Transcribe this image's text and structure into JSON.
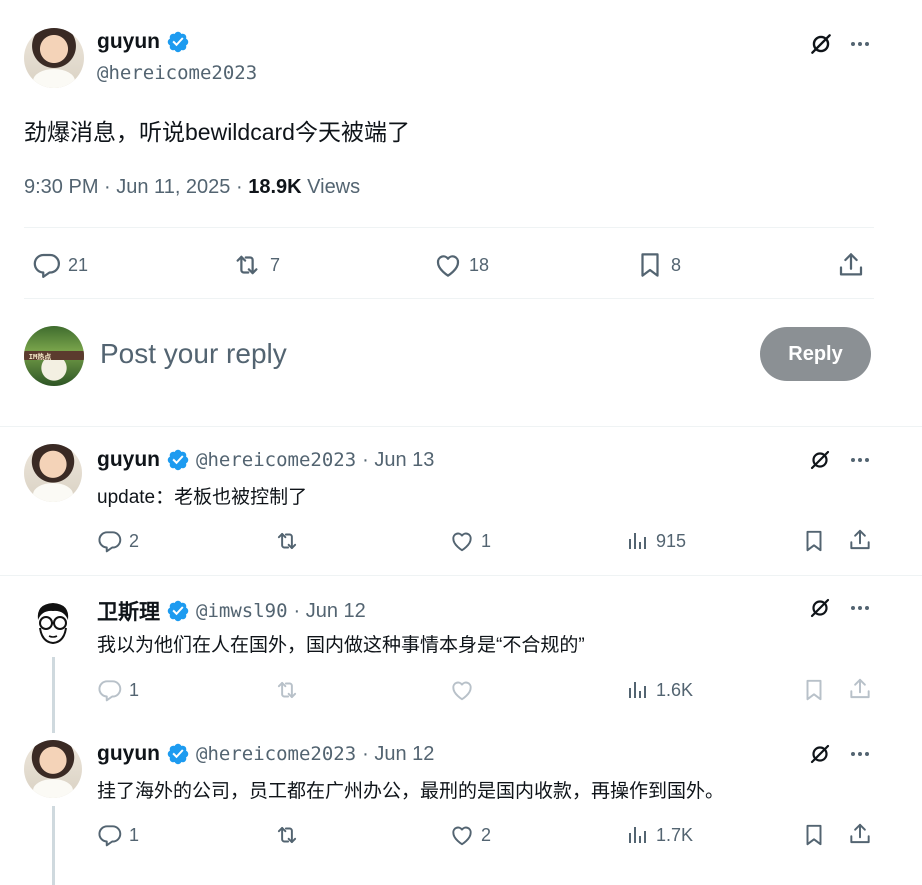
{
  "main_post": {
    "author": "guyun",
    "handle": "@hereicome2023",
    "text": "劲爆消息，听说bewildcard今天被端了",
    "time": "9:30 PM · Jun 11, 2025 · ",
    "views_count": "18.9K",
    "views_label": "Views",
    "actions": {
      "replies": "21",
      "reposts": "7",
      "likes": "18",
      "bookmarks": "8"
    }
  },
  "composer": {
    "placeholder": "Post your reply",
    "button_label": "Reply"
  },
  "replies": [
    {
      "author": "guyun",
      "handle": "@hereicome2023",
      "date": "· Jun 13",
      "text": "update：老板也被控制了",
      "actions": {
        "replies": "2",
        "reposts": "",
        "likes": "1",
        "views": "915"
      }
    },
    {
      "author": "卫斯理",
      "handle": "@imwsl90",
      "date": "· Jun 12",
      "text": "我以为他们在人在国外，国内做这种事情本身是“不合规的”",
      "actions": {
        "replies": "1",
        "reposts": "",
        "likes": "",
        "views": "1.6K"
      }
    },
    {
      "author": "guyun",
      "handle": "@hereicome2023",
      "date": "· Jun 12",
      "text": "挂了海外的公司，员工都在广州办公，最刑的是国内收款，再操作到国外。",
      "actions": {
        "replies": "1",
        "reposts": "",
        "likes": "2",
        "views": "1.7K"
      }
    }
  ],
  "colors": {
    "verified": "#1d9bf0",
    "muted": "#536471",
    "reply_button": "#8b9094"
  }
}
